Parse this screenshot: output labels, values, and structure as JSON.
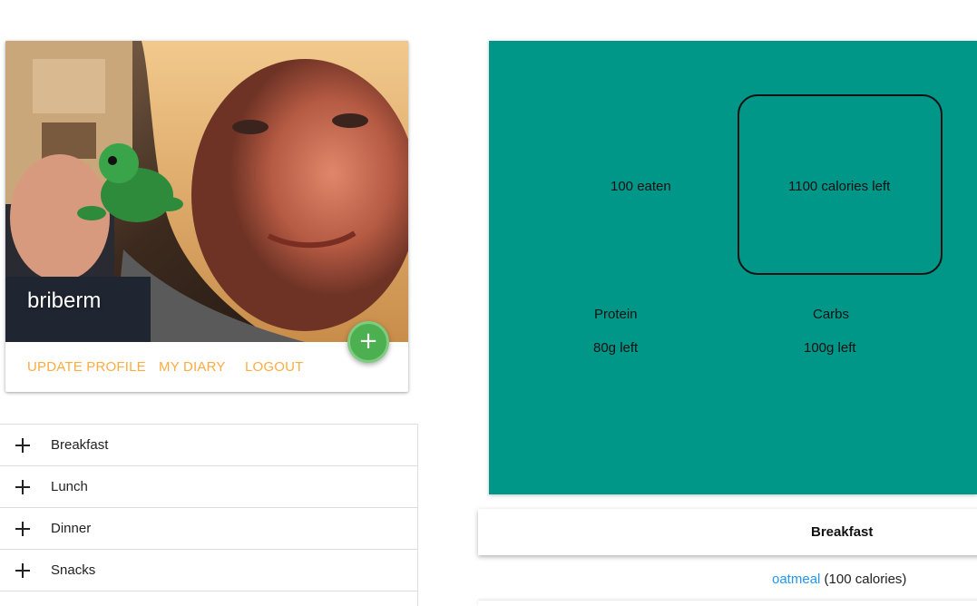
{
  "profile": {
    "username": "briberm",
    "actions": [
      "UPDATE PROFILE",
      "MY DIARY",
      "LOGOUT"
    ],
    "add_button_icon": "+"
  },
  "meals": [
    {
      "label": "Breakfast"
    },
    {
      "label": "Lunch"
    },
    {
      "label": "Dinner"
    },
    {
      "label": "Snacks"
    }
  ],
  "summary": {
    "eaten": "100 eaten",
    "calories_left": "1100 calories left",
    "protein_label": "Protein",
    "protein_left": "80g left",
    "carbs_label": "Carbs",
    "carbs_left": "100g left",
    "background_color": "#009688"
  },
  "breakfast_section": {
    "title": "Breakfast",
    "food_name": "oatmeal",
    "food_calories": "(100 calories)"
  },
  "colors": {
    "accent": "#ffab40",
    "fab": "#4caf50",
    "link": "#2196f3"
  }
}
